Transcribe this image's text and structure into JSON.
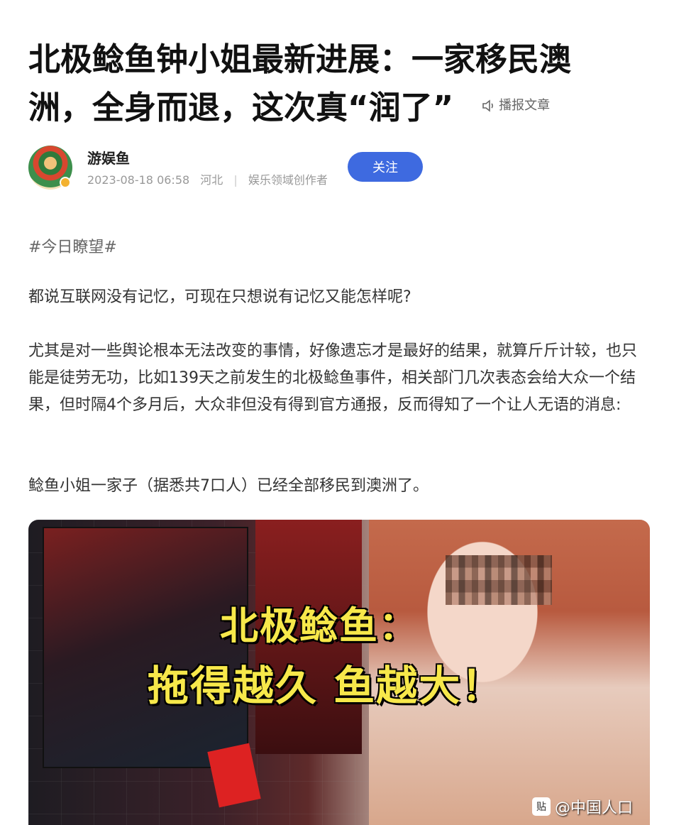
{
  "article": {
    "title_line1": "北极鲶鱼钟小姐最新进展：一家移民澳",
    "title_line2": "洲，全身而退，这次真“润了”",
    "read_label": "播报文章"
  },
  "author": {
    "name": "游娱鱼",
    "datetime": "2023-08-18 06:58",
    "location": "河北",
    "role": "娱乐领域创作者",
    "follow_label": "关注"
  },
  "content": {
    "hashtag": "#今日瞭望#",
    "paragraphs": [
      "都说互联网没有记忆，可现在只想说有记忆又能怎样呢?",
      "尤其是对一些舆论根本无法改变的事情，好像遗忘才是最好的结果，就算斤斤计较，也只能是徒劳无功，比如139天之前发生的北极鲶鱼事件，相关部门几次表态会给大众一个结果，但时隔4个多月后，大众非但没有得到官方通报，反而得知了一个让人无语的消息:",
      "鲶鱼小姐一家子（据悉共7口人）已经全部移民到澳洲了。"
    ]
  },
  "image": {
    "overlay_line1": "北极鲶鱼：",
    "overlay_line2": "拖得越久 鱼越大！",
    "watermark": "@中国人口",
    "watermark_icon": "贴"
  }
}
